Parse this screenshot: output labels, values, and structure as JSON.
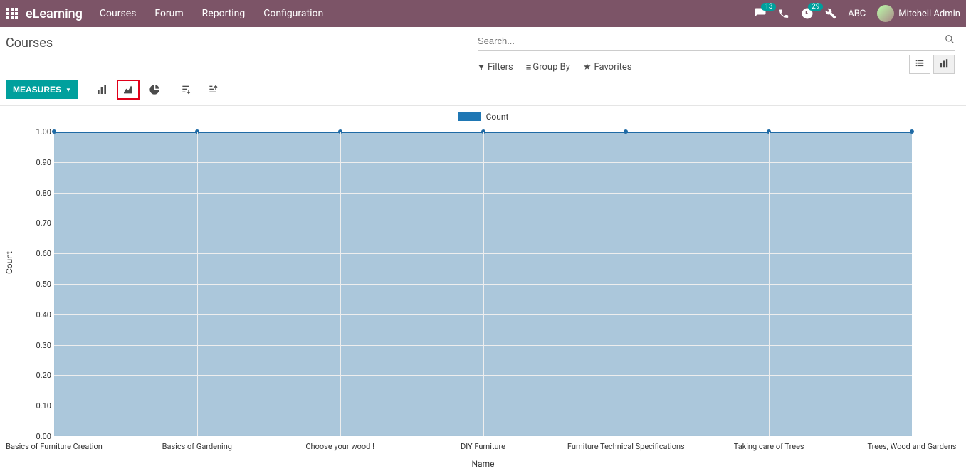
{
  "brand": "eLearning",
  "nav": [
    "Courses",
    "Forum",
    "Reporting",
    "Configuration"
  ],
  "badges": {
    "chat": "13",
    "activity": "29"
  },
  "company": "ABC",
  "user": "Mitchell Admin",
  "page_title": "Courses",
  "search": {
    "placeholder": "Search..."
  },
  "filters": {
    "filters_label": "Filters",
    "groupby_label": "Group By",
    "favorites_label": "Favorites"
  },
  "toolbar": {
    "measures_label": "MEASURES"
  },
  "legend": {
    "count_label": "Count"
  },
  "chart_data": {
    "type": "area",
    "categories": [
      "Basics of Furniture Creation",
      "Basics of Gardening",
      "Choose your wood !",
      "DIY Furniture",
      "Furniture Technical Specifications",
      "Taking care of Trees",
      "Trees, Wood and Gardens"
    ],
    "values": [
      1,
      1,
      1,
      1,
      1,
      1,
      1
    ],
    "series": [
      {
        "name": "Count",
        "values": [
          1,
          1,
          1,
          1,
          1,
          1,
          1
        ]
      }
    ],
    "xlabel": "Name",
    "ylabel": "Count",
    "ylim": [
      0,
      1
    ],
    "y_ticks": [
      "0.00",
      "0.10",
      "0.20",
      "0.30",
      "0.40",
      "0.50",
      "0.60",
      "0.70",
      "0.80",
      "0.90",
      "1.00"
    ],
    "title": ""
  }
}
